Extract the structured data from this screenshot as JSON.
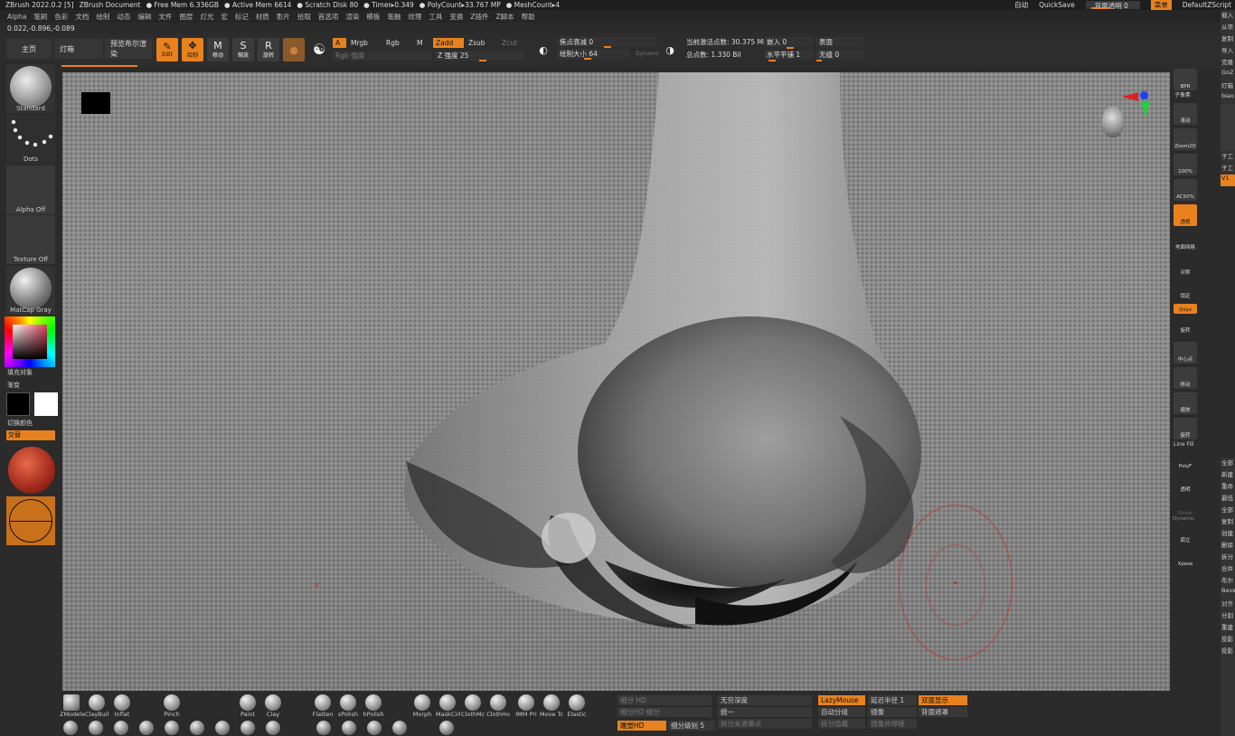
{
  "titlebar": {
    "items": [
      "ZBrush 2022.0.2 [5]",
      "ZBrush Document",
      "● Free Mem 6.336GB",
      "● Active Mem 6614",
      "● Scratch Disk 80",
      "● Timer▸0.349",
      "● PolyCount▸33.767 MP",
      "● MeshCount▸4"
    ],
    "auto": "自动",
    "quicksave": "QuickSave",
    "bg_opacity": "背面透明 0",
    "menu": "菜单",
    "script": "DefaultZScript"
  },
  "menubar": [
    "Alpha",
    "笔刷",
    "色彩",
    "文档",
    "绘制",
    "动态",
    "编辑",
    "文件",
    "图层",
    "灯光",
    "宏",
    "标记",
    "材质",
    "影片",
    "拾取",
    "首选项",
    "渲染",
    "模板",
    "笔触",
    "纹理",
    "工具",
    "变换",
    "Z插件",
    "Z脚本",
    "帮助"
  ],
  "coords": "0.022,-0.896,-0.089",
  "toolbar": {
    "tab_home": "主页",
    "tab_lightbox": "灯箱",
    "tab_preview": "预览布尔渲染",
    "edit": "Edit",
    "draw": "绘制",
    "move": "移动",
    "scale": "缩放",
    "rotate": "旋转",
    "a_label": "A",
    "mrgb": "Mrgb",
    "rgb": "Rgb",
    "m": "M",
    "rgb_intensity": "Rgb 强度",
    "zadd": "Zadd",
    "zsub": "Zsub",
    "zcut": "Zcut",
    "z_intensity": "Z 强度 25",
    "focal_shift": "焦点衰减 0",
    "draw_size": "绘制大小 64",
    "dynamic": "Dynamic",
    "active_points": "当前激活点数: 30.375 Mil",
    "total_points": "总点数: 1.330 Bil",
    "embed": "嵌入 0",
    "horizontal": "水平平铺 1",
    "surface": "表面",
    "seamless": "无缝 0"
  },
  "leftpanel": {
    "standard": "Standard",
    "dots": "Dots",
    "alpha_off": "Alpha Off",
    "texture_off": "Texture Off",
    "matcap": "MatCap Gray",
    "fill_object": "填充对象",
    "gradient": "渐变",
    "switch_color": "切换颜色",
    "alternate": "交替"
  },
  "rightbar": [
    "BPR",
    "子像素",
    "滚动",
    "Zoom2D",
    "100%",
    "AC50%",
    "透视",
    "地面网格",
    "对称",
    "锁定",
    "Qxyz",
    "旋转",
    "中心点",
    "移动",
    "缩放",
    "旋转",
    "Line Fill",
    "PolyF",
    "透明",
    "Ghost",
    "Dynamic",
    "孤立",
    "Xpose"
  ],
  "farright": [
    "载入",
    "从项",
    "复制",
    "导入",
    "克隆",
    "GoZ",
    "灯箱",
    "biao",
    "子工",
    "子工",
    "V1",
    "全部",
    "新建",
    "重命",
    "最低",
    "全部",
    "复制",
    "创建",
    "删除",
    "拆分",
    "合并",
    "布尔",
    "Bevel",
    "对齐",
    "分割",
    "重建",
    "投影",
    "投影"
  ],
  "bottom": {
    "brushes": [
      "ZModele",
      "ClayBuil",
      "Inflat",
      "Pinch",
      "Paint",
      "Clay",
      "Flatten",
      "sPolish",
      "hPolish",
      "Morph",
      "MaskCirl",
      "ClothMc",
      "ClothHo",
      "IMM Pri",
      "Move Tc",
      "Elastic"
    ],
    "divide_hd": "细分 HD",
    "divide_hd2": "细分HD 细分",
    "sculpt_hd": "雕塑HD",
    "subdiv_level": "细分级别 5",
    "infinite_depth": "无穷深度",
    "unify": "统一",
    "split_unmasked": "拆分未遮罩点",
    "lazymouse": "LazyMouse",
    "auto_group": "自动分组",
    "split_hidden": "拆分隐藏",
    "lazy_radius": "延迟半径 1",
    "mirror": "镜像",
    "mirror_weld": "镜像并焊接",
    "double_display": "双面显示",
    "back_mask": "背面遮罩"
  },
  "colors": {
    "accent": "#e8821e",
    "surface": "#8a8a8a",
    "panel": "#2b2b2b"
  }
}
